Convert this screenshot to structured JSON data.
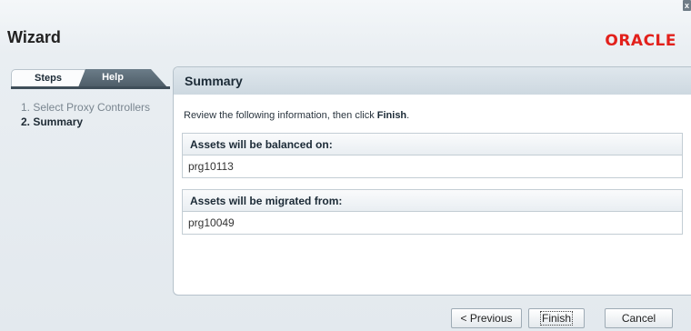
{
  "window": {
    "close_label": "x"
  },
  "header": {
    "title": "Wizard",
    "logo": "ORACLE"
  },
  "tabs": [
    {
      "label": "Steps"
    },
    {
      "label": "Help"
    }
  ],
  "steps": [
    {
      "label": "1. Select Proxy Controllers"
    },
    {
      "label": "2. Summary"
    }
  ],
  "panel": {
    "title": "Summary",
    "instructions_prefix": "Review the following information, then click ",
    "instructions_bold": "Finish",
    "instructions_suffix": ".",
    "sections": [
      {
        "header": "Assets will be balanced on:",
        "value": "prg10113"
      },
      {
        "header": "Assets will be migrated from:",
        "value": "prg10049"
      }
    ]
  },
  "buttons": {
    "previous": "< Previous",
    "finish": "Finish",
    "cancel": "Cancel"
  }
}
